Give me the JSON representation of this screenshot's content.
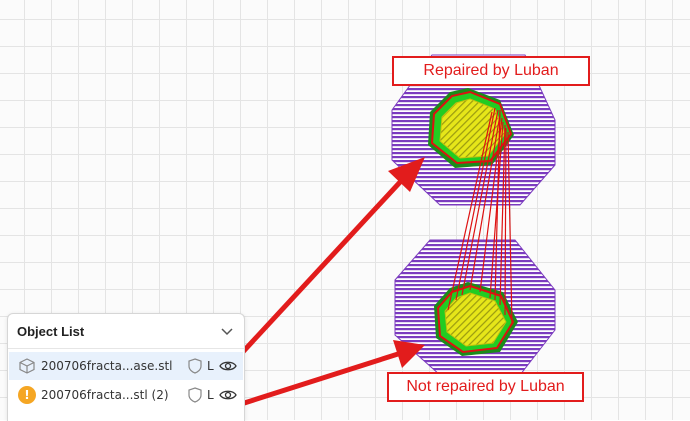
{
  "annotations": {
    "top_label": "Repaired by Luban",
    "bottom_label": "Not repaired by Luban"
  },
  "object_list": {
    "title": "Object List",
    "items": [
      {
        "name": "200706fracta...ase.stl",
        "icon": "cube-icon",
        "letter": "L",
        "selected": true
      },
      {
        "name": "200706fracta...stl (2)",
        "icon": "warning-icon",
        "letter": "L",
        "selected": false
      }
    ]
  },
  "colors": {
    "annotation_red": "#e21c1c",
    "infill_purple": "#7b3bbf",
    "wall_green": "#22cc22",
    "top_yellow": "#e6e619",
    "warning_orange": "#f5a623",
    "selection_blue": "#e8f1fc"
  }
}
